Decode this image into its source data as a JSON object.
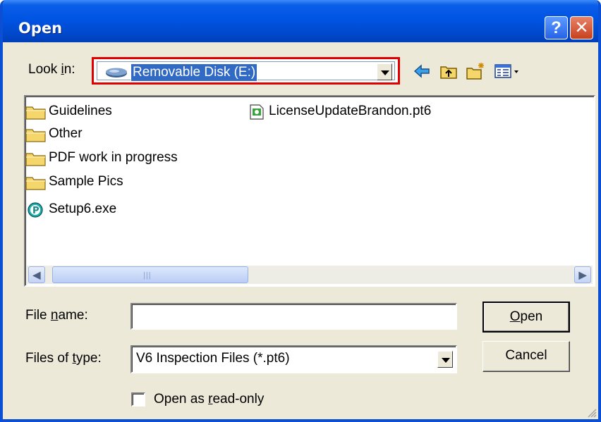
{
  "window": {
    "title": "Open",
    "help_glyph": "?",
    "close_glyph": "✕"
  },
  "lookin": {
    "label_pre": "Look ",
    "label_key": "i",
    "label_post": "n:",
    "value": "Removable Disk (E:)",
    "icon": "removable-disk-icon",
    "highlight_color": "#e00000"
  },
  "toolbar": {
    "icons": [
      "back-arrow-icon",
      "up-one-level-icon",
      "new-folder-icon",
      "view-menu-icon"
    ]
  },
  "files": {
    "items": [
      {
        "name": "Guidelines",
        "icon": "folder-icon"
      },
      {
        "name": "Other",
        "icon": "folder-icon"
      },
      {
        "name": "PDF work in progress",
        "icon": "folder-icon"
      },
      {
        "name": "Sample Pics",
        "icon": "folder-icon"
      },
      {
        "name": "Setup6.exe",
        "icon": "setup-exe-icon"
      },
      {
        "name": "LicenseUpdateBrandon.pt6",
        "icon": "pt6-file-icon"
      }
    ]
  },
  "filename": {
    "label_pre": "File ",
    "label_key": "n",
    "label_post": "ame:",
    "value": "",
    "placeholder": ""
  },
  "filetype": {
    "label_pre": "Files of ",
    "label_key": "t",
    "label_post": "ype:",
    "value": "V6 Inspection Files (*.pt6)"
  },
  "buttons": {
    "open_key": "O",
    "open_rest": "pen",
    "cancel": "Cancel"
  },
  "readonly": {
    "label_pre": "Open as ",
    "label_key": "r",
    "label_post": "ead-only",
    "checked": false
  },
  "colors": {
    "titlebar": "#0054e3",
    "dialog_bg": "#ece9d8",
    "selection": "#316ac5"
  }
}
